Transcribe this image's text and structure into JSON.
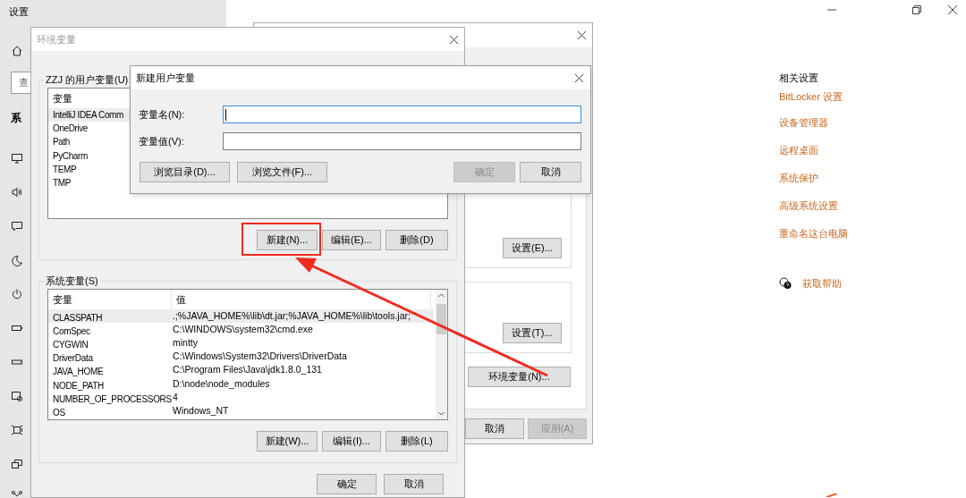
{
  "settings_window": {
    "title": "设置",
    "search_box": {
      "placeholder": "查"
    },
    "nav_heading": "系",
    "related_settings": {
      "heading": "相关设置",
      "links": [
        "BitLocker 设置",
        "设备管理器",
        "远程桌面",
        "系统保护",
        "高级系统设置",
        "重命名这台电脑"
      ]
    },
    "help_link": "获取帮助"
  },
  "system_properties": {
    "group_buttons": [
      {
        "label": "设置(E)...",
        "disabled": false
      },
      {
        "label": "设置(T)...",
        "disabled": false
      }
    ],
    "env_button": {
      "label": "环境变量(N)...",
      "disabled": false
    },
    "footer_buttons": [
      {
        "label": "取消",
        "disabled": false
      },
      {
        "label": "应用(A)",
        "disabled": true
      }
    ]
  },
  "env_vars": {
    "title": "环境变量",
    "active": false,
    "user_vars": {
      "label": "ZZJ 的用户变量(U)",
      "columns": [
        "变量"
      ],
      "rows": [
        {
          "name": "IntelliJ IDEA Comm",
          "selected": true
        },
        {
          "name": "OneDrive",
          "selected": false
        },
        {
          "name": "Path",
          "selected": false
        },
        {
          "name": "PyCharm",
          "selected": false
        },
        {
          "name": "TEMP",
          "selected": false
        },
        {
          "name": "TMP",
          "selected": false
        }
      ],
      "buttons": [
        {
          "label": "新建(N)...",
          "disabled": false
        },
        {
          "label": "编辑(E)...",
          "disabled": false
        },
        {
          "label": "删除(D)",
          "disabled": false
        }
      ]
    },
    "system_vars": {
      "label": "系统变量(S)",
      "columns": [
        "变量",
        "值"
      ],
      "rows": [
        {
          "name": "CLASSPATH",
          "value": ".;%JAVA_HOME%\\lib\\dt.jar;%JAVA_HOME%\\lib\\tools.jar;",
          "selected": true
        },
        {
          "name": "ComSpec",
          "value": "C:\\WINDOWS\\system32\\cmd.exe",
          "selected": false
        },
        {
          "name": "CYGWIN",
          "value": "mintty",
          "selected": false
        },
        {
          "name": "DriverData",
          "value": "C:\\Windows\\System32\\Drivers\\DriverData",
          "selected": false
        },
        {
          "name": "JAVA_HOME",
          "value": "C:\\Program Files\\Java\\jdk1.8.0_131",
          "selected": false
        },
        {
          "name": "NODE_PATH",
          "value": "D:\\node\\node_modules",
          "selected": false
        },
        {
          "name": "NUMBER_OF_PROCESSORS",
          "value": "4",
          "selected": false
        },
        {
          "name": "OS",
          "value": "Windows_NT",
          "selected": false
        }
      ],
      "buttons": [
        {
          "label": "新建(W)...",
          "disabled": false
        },
        {
          "label": "编辑(I)...",
          "disabled": false
        },
        {
          "label": "删除(L)",
          "disabled": false
        }
      ]
    },
    "footer_buttons": [
      {
        "label": "确定",
        "disabled": false
      },
      {
        "label": "取消",
        "disabled": false
      }
    ]
  },
  "new_var_dialog": {
    "title": "新建用户变量",
    "active": true,
    "fields": [
      {
        "label": "变量名(N):",
        "focused": true
      },
      {
        "label": "变量值(V):",
        "focused": false
      }
    ],
    "browse_buttons": [
      {
        "label": "浏览目录(D)...",
        "disabled": false
      },
      {
        "label": "浏览文件(F)...",
        "disabled": false
      }
    ],
    "action_buttons": [
      {
        "label": "确定",
        "disabled": true
      },
      {
        "label": "取消",
        "disabled": false
      }
    ]
  }
}
